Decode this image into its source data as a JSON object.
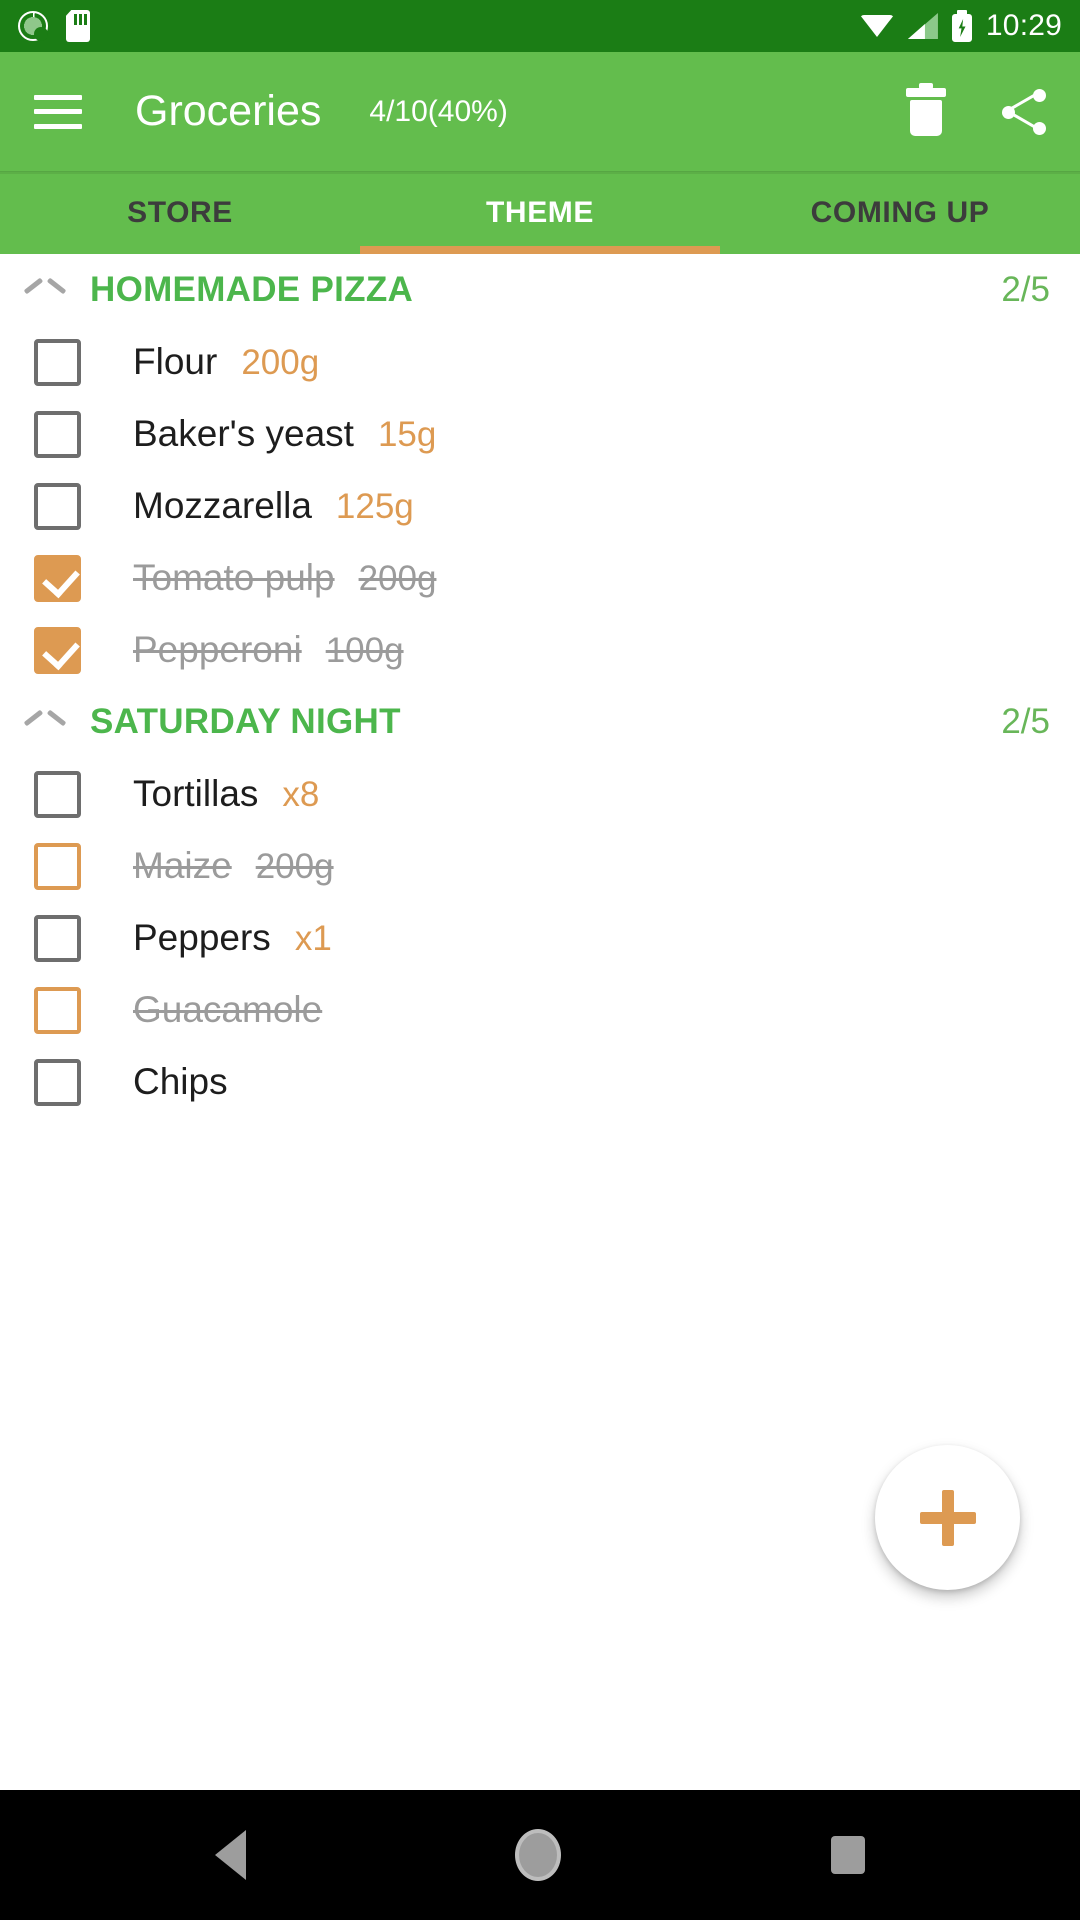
{
  "status_bar": {
    "icons_left": [
      "sync-icon",
      "sd-card-icon"
    ],
    "icons_right": [
      "wifi-icon",
      "cellular-signal-icon",
      "battery-charging-icon"
    ],
    "time": "10:29"
  },
  "app_bar": {
    "menu_icon": "hamburger-menu-icon",
    "title": "Groceries",
    "progress": "4/10(40%)",
    "actions": [
      {
        "icon": "trash-icon",
        "label": "Delete"
      },
      {
        "icon": "share-icon",
        "label": "Share"
      }
    ]
  },
  "tabs": {
    "active_index": 1,
    "items": [
      {
        "label": "STORE"
      },
      {
        "label": "THEME"
      },
      {
        "label": "COMING UP"
      }
    ]
  },
  "sections": [
    {
      "title": "HOMEMADE PIZZA",
      "count": "2/5",
      "collapse_icon": "chevron-up-icon",
      "items": [
        {
          "name": "Flour",
          "qty": "200g",
          "checked": false,
          "struck": false,
          "box": "grey"
        },
        {
          "name": "Baker's yeast",
          "qty": "15g",
          "checked": false,
          "struck": false,
          "box": "grey"
        },
        {
          "name": "Mozzarella",
          "qty": "125g",
          "checked": false,
          "struck": false,
          "box": "grey"
        },
        {
          "name": "Tomato pulp",
          "qty": "200g",
          "checked": true,
          "struck": true,
          "box": "orange-filled"
        },
        {
          "name": "Pepperoni",
          "qty": "100g",
          "checked": true,
          "struck": true,
          "box": "orange-filled"
        }
      ]
    },
    {
      "title": "SATURDAY NIGHT",
      "count": "2/5",
      "collapse_icon": "chevron-up-icon",
      "items": [
        {
          "name": "Tortillas",
          "qty": "x8",
          "checked": false,
          "struck": false,
          "box": "grey"
        },
        {
          "name": "Maize",
          "qty": "200g",
          "checked": false,
          "struck": true,
          "box": "orange-outline"
        },
        {
          "name": "Peppers",
          "qty": "x1",
          "checked": false,
          "struck": false,
          "box": "grey"
        },
        {
          "name": "Guacamole",
          "qty": "",
          "checked": false,
          "struck": true,
          "box": "orange-outline"
        },
        {
          "name": "Chips",
          "qty": "",
          "checked": false,
          "struck": false,
          "box": "grey"
        }
      ]
    }
  ],
  "fab": {
    "icon": "plus-icon",
    "label": "Add item"
  },
  "nav_bar": {
    "back_icon": "back-triangle-icon",
    "home_icon": "home-circle-icon",
    "recents_icon": "recents-square-icon"
  },
  "colors": {
    "status_bar": "#1b7d15",
    "app_bar": "#63bd4d",
    "accent_orange": "#dd9a52",
    "section_green": "#4cb64c",
    "done_grey": "#9b9b9b"
  }
}
